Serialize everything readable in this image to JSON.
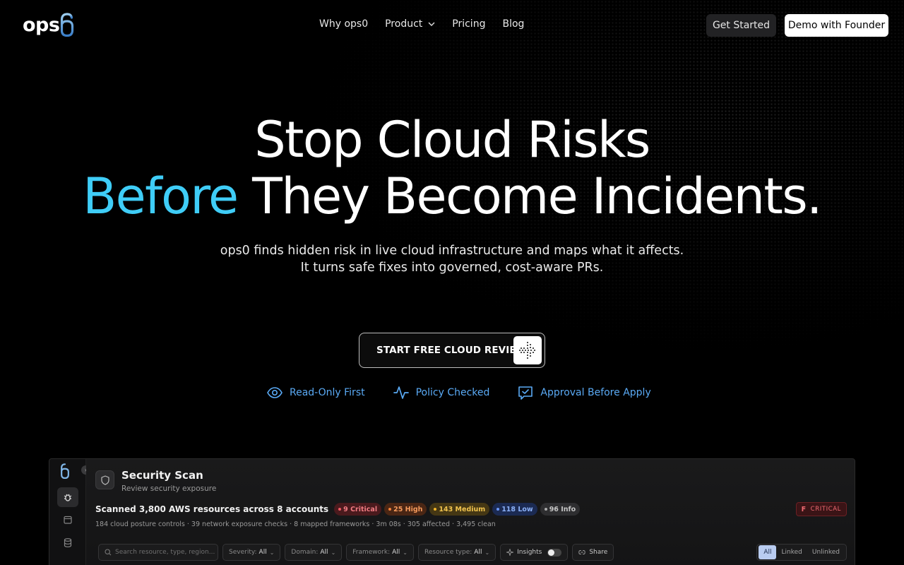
{
  "nav": {
    "logo_text": "ops",
    "links": [
      "Why ops0",
      "Product",
      "Pricing",
      "Blog"
    ],
    "get_started": "Get Started",
    "demo": "Demo with Founder"
  },
  "hero": {
    "headline_line1": "Stop Cloud Risks",
    "headline_accent": "Before",
    "headline_rest": " They Become Incidents.",
    "sub_line1": "ops0 finds hidden risk in live cloud infrastructure and maps what it affects.",
    "sub_line2": "It turns safe fixes into governed, cost-aware PRs.",
    "cta": "START FREE CLOUD REVIEW",
    "badges": [
      "Read-Only First",
      "Policy Checked",
      "Approval Before Apply"
    ],
    "accent_color": "#3fcdf7",
    "badge_color": "#5aaaf5"
  },
  "app": {
    "title": "Security Scan",
    "subtitle": "Review security exposure",
    "scan_summary": "Scanned 3,800 AWS resources across 8 accounts",
    "severities": {
      "critical": "9 Critical",
      "high": "25 High",
      "medium": "143 Medium",
      "low": "118 Low",
      "info": "96 Info"
    },
    "stats": "184 cloud posture controls · 39 network exposure checks · 8 mapped frameworks · 3m 08s · 305 affected · 3,495 clean",
    "grade_letter": "F",
    "grade_label": "CRITICAL",
    "filters": {
      "search_placeholder": "Search resource, type, region...",
      "severity_label": "Severity:",
      "severity_value": "All",
      "domain_label": "Domain:",
      "domain_value": "All",
      "framework_label": "Framework:",
      "framework_value": "All",
      "resource_label": "Resource type:",
      "resource_value": "All",
      "insights": "Insights",
      "share": "Share",
      "segments": [
        "All",
        "Linked",
        "Unlinked"
      ]
    }
  }
}
